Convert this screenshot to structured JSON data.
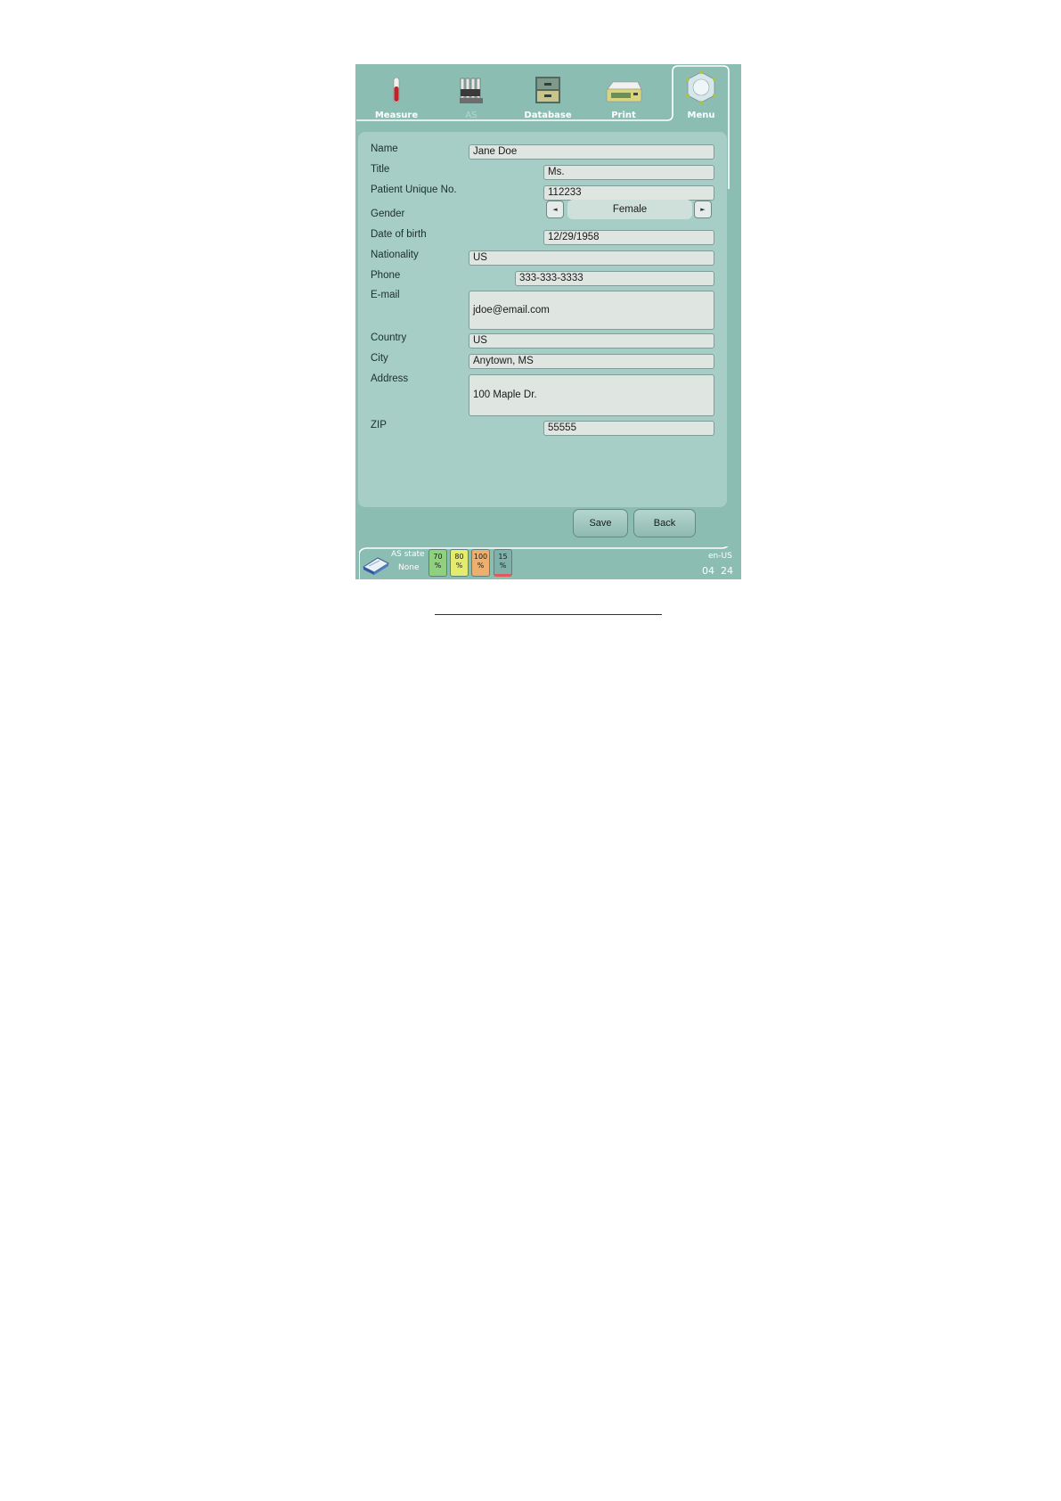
{
  "nav": {
    "tabs": [
      {
        "label": "Measure",
        "icon": "test-tube-icon"
      },
      {
        "label": "AS",
        "icon": "sample-rack-icon"
      },
      {
        "label": "Database",
        "icon": "database-cabinet-icon"
      },
      {
        "label": "Print",
        "icon": "printer-icon"
      },
      {
        "label": "Menu",
        "icon": "menu-hub-icon"
      }
    ]
  },
  "form": {
    "name": {
      "label": "Name",
      "value": "Jane Doe"
    },
    "title": {
      "label": "Title",
      "value": "Ms."
    },
    "patient_no": {
      "label": "Patient Unique No.",
      "value": "112233"
    },
    "gender": {
      "label": "Gender",
      "value": "Female",
      "prev": "◄",
      "next": "►"
    },
    "dob": {
      "label": "Date of birth",
      "value": "12/29/1958"
    },
    "nationality": {
      "label": "Nationality",
      "value": "US"
    },
    "phone": {
      "label": "Phone",
      "value": "333-333-3333"
    },
    "email": {
      "label": "E-mail",
      "value": "jdoe@email.com"
    },
    "country": {
      "label": "Country",
      "value": "US"
    },
    "city": {
      "label": "City",
      "value": "Anytown, MS"
    },
    "address": {
      "label": "Address",
      "value": "100 Maple Dr."
    },
    "zip": {
      "label": "ZIP",
      "value": "55555"
    }
  },
  "buttons": {
    "save": "Save",
    "back": "Back"
  },
  "status": {
    "as_state_label": "AS state",
    "as_state_value": "None",
    "gauges": [
      {
        "value": "70",
        "unit": "%",
        "color": "#8fd17f"
      },
      {
        "value": "80",
        "unit": "%",
        "color": "#e3ec6e"
      },
      {
        "value": "100",
        "unit": "%",
        "color": "#eeae6c"
      },
      {
        "value": "15",
        "unit": "%",
        "color": "#7fb0a9"
      }
    ],
    "locale": "en-US",
    "time_hour": "04",
    "time_min": "24"
  },
  "colors": {
    "background": "#8cbdb3",
    "panel": "#a6cec6",
    "field": "#dfe5e1"
  }
}
